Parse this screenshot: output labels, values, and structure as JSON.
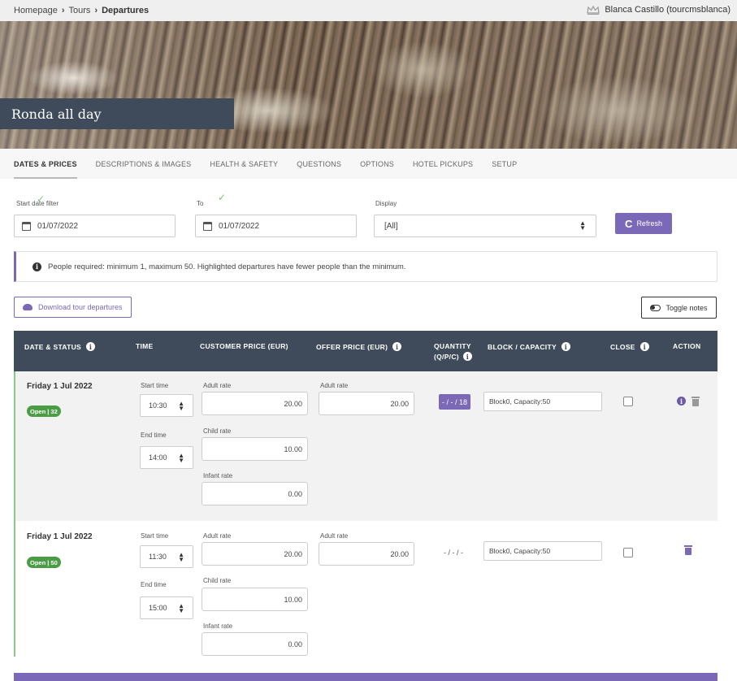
{
  "breadcrumb": {
    "home": "Homepage",
    "sep1": "›",
    "tours": "Tours",
    "sep2": "›",
    "current": "Departures"
  },
  "user": {
    "name": "Blanca Castillo (tourcmsblanca)",
    "icon": "crown-icon"
  },
  "hero": {
    "title": "Ronda all day"
  },
  "tabs": [
    {
      "label": "DATES & PRICES",
      "active": true
    },
    {
      "label": "DESCRIPTIONS & IMAGES"
    },
    {
      "label": "HEALTH & SAFETY"
    },
    {
      "label": "QUESTIONS"
    },
    {
      "label": "OPTIONS"
    },
    {
      "label": "HOTEL PICKUPS"
    },
    {
      "label": "SETUP"
    }
  ],
  "filters": {
    "start_label": "Start date filter",
    "start_value": "01/07/2022",
    "to_label": "To",
    "to_value": "01/07/2022",
    "display_label": "Display",
    "display_value": "[All]",
    "check_glyph": "✓",
    "refresh_label": "Refresh",
    "refresh_glyph": "C"
  },
  "info": {
    "glyph": "i",
    "text": "People required: minimum 1, maximum 50. Highlighted departures have fewer people than the minimum."
  },
  "actions": {
    "download_label": "Download tour departures",
    "toggle_label": "Toggle notes"
  },
  "table": {
    "headers": {
      "date": "DATE & STATUS",
      "time": "TIME",
      "customer": "CUSTOMER PRICE (EUR)",
      "offer": "OFFER PRICE (EUR)",
      "quantity": "QUANTITY",
      "quantity_sub": "(Q/P/C)",
      "block": "BLOCK / CAPACITY",
      "close": "CLOSE",
      "action": "ACTION"
    },
    "rows": [
      {
        "day": "Friday 1 Jul 2022",
        "status": "Open | 32",
        "start_label": "Start time",
        "start": "10:30",
        "end_label": "End time",
        "end": "14:00",
        "adult_label": "Adult rate",
        "adult": "20.00",
        "child_label": "Child rate",
        "child": "10.00",
        "infant_label": "Infant rate",
        "infant": "0.00",
        "offer_label": "Adult rate",
        "offer": "20.00",
        "quantity": "- / - / 18",
        "block": "Block0, Capacity:50",
        "info_glyph": "i"
      },
      {
        "day": "Friday 1 Jul 2022",
        "status": "Open | 50",
        "start_label": "Start time",
        "start": "11:30",
        "end_label": "End time",
        "end": "15:00",
        "adult_label": "Adult rate",
        "adult": "20.00",
        "child_label": "Child rate",
        "child": "10.00",
        "infant_label": "Infant rate",
        "infant": "0.00",
        "offer_label": "Adult rate",
        "offer": "20.00",
        "quantity": "- / - / -",
        "block": "Block0, Capacity:50"
      }
    ]
  },
  "colors": {
    "accent": "#7b68b6",
    "header": "#3f4b5b",
    "open": "#4a9d45",
    "check": "#7ec47e"
  }
}
